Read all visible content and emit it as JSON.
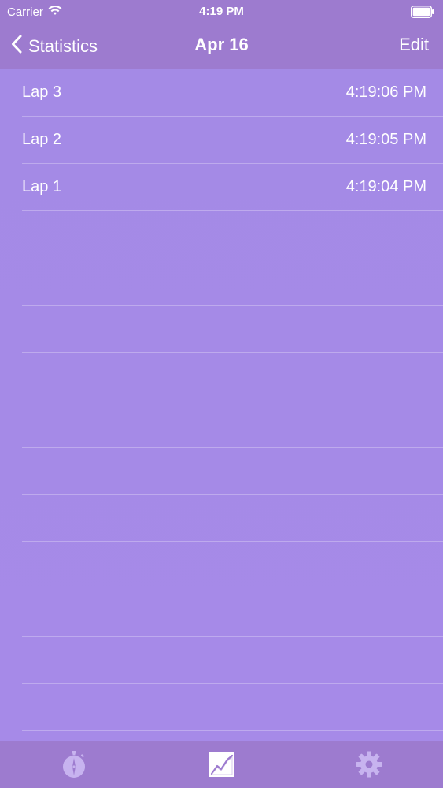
{
  "status_bar": {
    "carrier": "Carrier",
    "time": "4:19 PM",
    "wifi_icon": "wifi-icon",
    "battery_icon": "battery-icon"
  },
  "nav": {
    "back_label": "Statistics",
    "title": "Apr 16",
    "edit_label": "Edit"
  },
  "laps": [
    {
      "label": "Lap 3",
      "time": "4:19:06 PM"
    },
    {
      "label": "Lap 2",
      "time": "4:19:05 PM"
    },
    {
      "label": "Lap 1",
      "time": "4:19:04 PM"
    }
  ],
  "tab_bar": {
    "tabs": [
      {
        "icon": "stopwatch-icon",
        "active": false
      },
      {
        "icon": "chart-icon",
        "active": true
      },
      {
        "icon": "gear-icon",
        "active": false
      }
    ]
  },
  "colors": {
    "bar": "#9d7bcf",
    "background": "#a48ae6",
    "inactive_icon": "#c7b3ef",
    "text": "#ffffff"
  }
}
